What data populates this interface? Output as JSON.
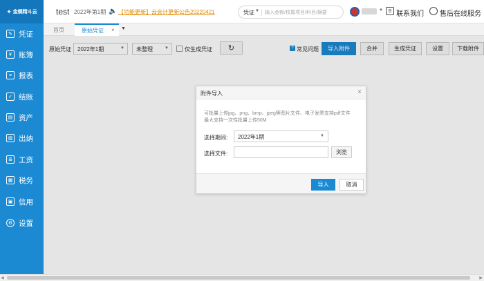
{
  "brand": {
    "logo_text": "金蝶精斗云",
    "logo_icon": "logo-icon"
  },
  "header": {
    "company": "test",
    "period": "2022年第1期",
    "notice": "【功能更新】云会计更新公告20220421",
    "search": {
      "type": "凭证",
      "placeholder": "输入金额/核算项目/科目/摘要"
    },
    "contact": "联系我们",
    "service": "售后在线服务"
  },
  "sidebar": {
    "items": [
      {
        "label": "凭证",
        "icon": "voucher-icon"
      },
      {
        "label": "账簿",
        "icon": "ledger-icon"
      },
      {
        "label": "报表",
        "icon": "report-icon"
      },
      {
        "label": "结账",
        "icon": "checkout-icon"
      },
      {
        "label": "资产",
        "icon": "asset-icon"
      },
      {
        "label": "出纳",
        "icon": "cashier-icon"
      },
      {
        "label": "工资",
        "icon": "salary-icon"
      },
      {
        "label": "税务",
        "icon": "tax-icon"
      },
      {
        "label": "信用",
        "icon": "credit-icon"
      },
      {
        "label": "设置",
        "icon": "settings-icon"
      }
    ]
  },
  "tabs": {
    "home": "首页",
    "active": "原始凭证"
  },
  "toolbar": {
    "label": "原始凭证",
    "period_value": "2022年1期",
    "status_value": "未整理",
    "only_generated": "仅生成凭证",
    "faq": "常见问题",
    "import": "导入附件",
    "merge": "合并",
    "generate": "生成凭证",
    "settings": "设置",
    "download": "下载附件"
  },
  "dialog": {
    "title": "附件导入",
    "hint_line1": "可批量上传jpg、png、bmp、jpeg等图片文件、电子发票支持pdf文件",
    "hint_line2": "最大支持一次性批量上传50M",
    "period_label": "选择期间:",
    "period_value": "2022年1期",
    "file_label": "选择文件:",
    "file_value": "",
    "browse": "浏览",
    "ok": "导入",
    "cancel": "取消"
  },
  "colors": {
    "accent": "#1b8ad3",
    "notice": "#e08a00"
  }
}
